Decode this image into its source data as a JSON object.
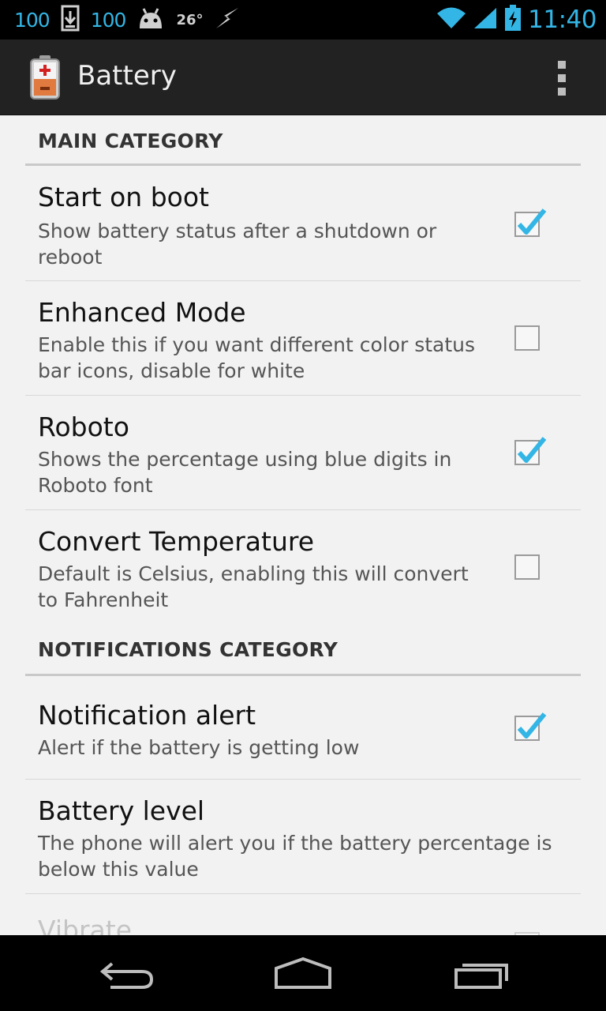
{
  "status_bar": {
    "left_num_1": "100",
    "left_num_2": "100",
    "temperature": "26°",
    "time": "11:40",
    "accent": "#33b5e5",
    "icons": [
      "battery-percent-text",
      "download-icon",
      "android-icon",
      "weather-icon",
      "wifi-icon",
      "signal-icon",
      "battery-charging-icon"
    ]
  },
  "action_bar": {
    "title": "Battery",
    "icon": "battery-app-icon",
    "overflow_icon": "overflow-menu-icon"
  },
  "categories": {
    "main": "MAIN CATEGORY",
    "notifications": "NOTIFICATIONS CATEGORY"
  },
  "prefs": {
    "start_on_boot": {
      "title": "Start on boot",
      "summary": "Show battery status after a shutdown or reboot",
      "checked": true
    },
    "enhanced_mode": {
      "title": "Enhanced Mode",
      "summary": "Enable this if you want different color status bar icons, disable for white",
      "checked": false
    },
    "roboto": {
      "title": "Roboto",
      "summary": "Shows the percentage using blue digits in Roboto font",
      "checked": true
    },
    "convert_temperature": {
      "title": "Convert Temperature",
      "summary": "Default is Celsius, enabling this will convert to Fahrenheit",
      "checked": false
    },
    "notification_alert": {
      "title": "Notification alert",
      "summary": "Alert if the battery is getting low",
      "checked": true
    },
    "battery_level": {
      "title": "Battery level",
      "summary": "The phone will alert you if the battery percentage is below this value"
    },
    "vibrate": {
      "title": "Vibrate"
    }
  },
  "nav_bar": {
    "icons": [
      "back-icon",
      "home-icon",
      "recents-icon"
    ]
  }
}
